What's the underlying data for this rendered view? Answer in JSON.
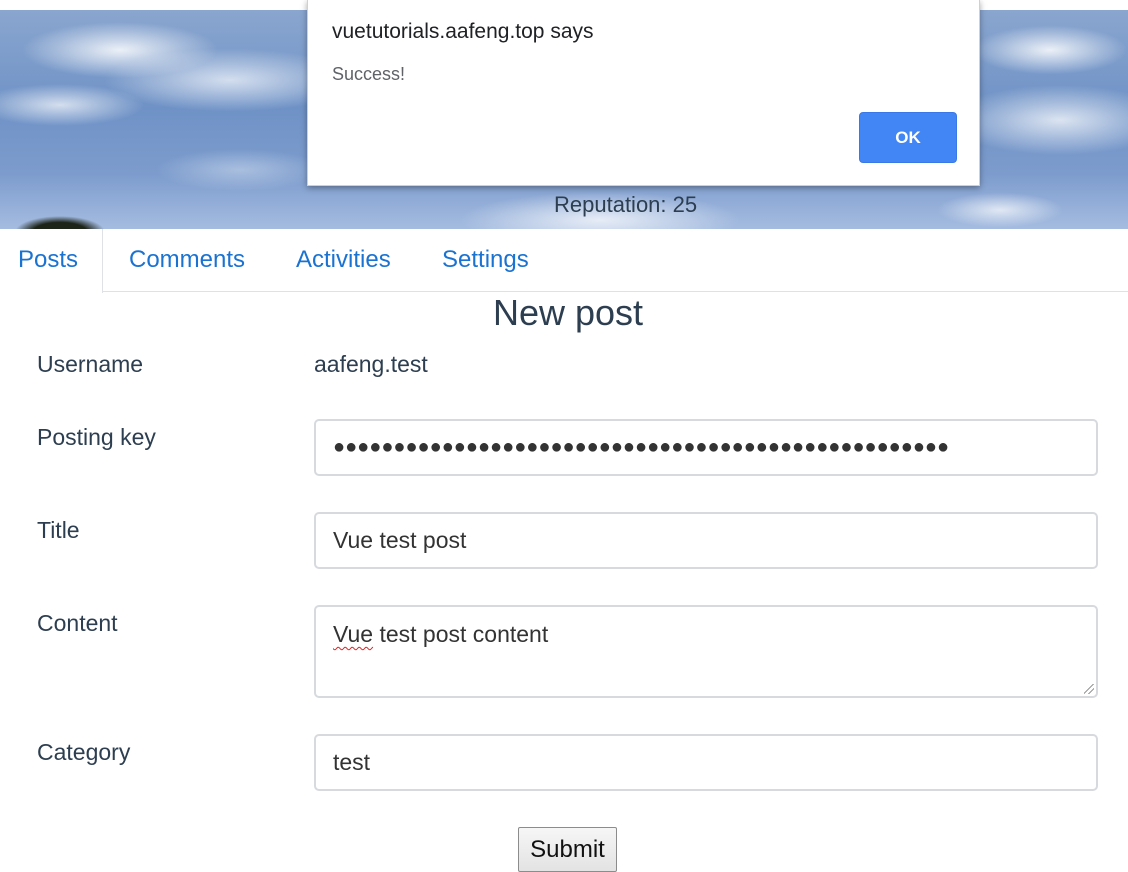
{
  "banner": {
    "reputation": "Reputation: 25"
  },
  "dialog": {
    "title": "vuetutorials.aafeng.top says",
    "message": "Success!",
    "ok_label": "OK"
  },
  "tabs": [
    {
      "label": "Posts",
      "active": true
    },
    {
      "label": "Comments",
      "active": false
    },
    {
      "label": "Activities",
      "active": false
    },
    {
      "label": "Settings",
      "active": false
    }
  ],
  "form": {
    "heading": "New post",
    "username_label": "Username",
    "username_value": "aafeng.test",
    "posting_key_label": "Posting key",
    "posting_key_masked": "●●●●●●●●●●●●●●●●●●●●●●●●●●●●●●●●●●●●●●●●●●●●●●●●●●●",
    "title_label": "Title",
    "title_value": "Vue test post",
    "content_label": "Content",
    "content_value_first_word": "Vue",
    "content_value_rest": " test post content",
    "category_label": "Category",
    "category_value": "test",
    "submit_label": "Submit"
  },
  "colors": {
    "tab_link": "#1a73d2",
    "dialog_button": "#4285f4",
    "text": "#2c3e50"
  }
}
